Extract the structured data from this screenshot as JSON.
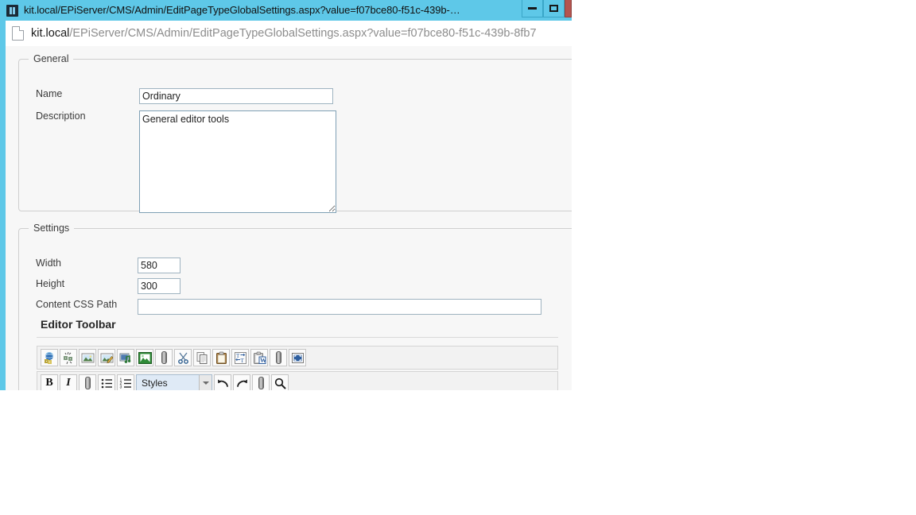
{
  "window": {
    "title": "kit.local/EPiServer/CMS/Admin/EditPageTypeGlobalSettings.aspx?value=f07bce80-f51c-439b-…",
    "favicon_name": "episerver-favicon",
    "minimize_label": "Minimize",
    "maximize_label": "Maximize",
    "close_label": "Close",
    "accent_color": "#5ec8e8"
  },
  "address_bar": {
    "host": "kit.local",
    "path": "/EPiServer/CMS/Admin/EditPageTypeGlobalSettings.aspx?value=f07bce80-f51c-439b-8fb7",
    "page_icon_name": "page-icon"
  },
  "general": {
    "legend": "General",
    "name_label": "Name",
    "name_value": "Ordinary",
    "description_label": "Description",
    "description_value": "General editor tools"
  },
  "settings": {
    "legend": "Settings",
    "width_label": "Width",
    "width_value": "580",
    "height_label": "Height",
    "height_value": "300",
    "css_path_label": "Content CSS Path",
    "css_path_value": "",
    "css_path_placeholder": "",
    "editor_toolbar_heading": "Editor Toolbar"
  },
  "toolbar": {
    "row1": [
      {
        "name": "insert-edit-link-icon",
        "title": "Insert/edit link"
      },
      {
        "name": "unlink-icon",
        "title": "Unlink"
      },
      {
        "name": "insert-image-icon",
        "title": "Insert/edit image"
      },
      {
        "name": "edit-image-icon",
        "title": "Edit image"
      },
      {
        "name": "insert-media-icon",
        "title": "Insert/edit media"
      },
      {
        "name": "image-editor-icon",
        "title": "Image editor"
      },
      {
        "name": "separator-icon",
        "title": "Separator"
      },
      {
        "name": "cut-icon",
        "title": "Cut"
      },
      {
        "name": "copy-icon",
        "title": "Copy"
      },
      {
        "name": "paste-icon",
        "title": "Paste"
      },
      {
        "name": "paste-as-plain-text-icon",
        "title": "Paste as plain text"
      },
      {
        "name": "paste-from-word-icon",
        "title": "Paste from Word"
      },
      {
        "name": "separator-icon",
        "title": "Separator"
      },
      {
        "name": "fullscreen-icon",
        "title": "Fullscreen"
      }
    ],
    "row2": [
      {
        "name": "bold-icon",
        "title": "Bold",
        "glyph": "B"
      },
      {
        "name": "italic-icon",
        "title": "Italic",
        "glyph": "I"
      },
      {
        "name": "separator-icon",
        "title": "Separator",
        "glyph": ""
      },
      {
        "name": "bullet-list-icon",
        "title": "Bullet list",
        "glyph": ""
      },
      {
        "name": "numbered-list-icon",
        "title": "Numbered list",
        "glyph": ""
      },
      {
        "name": "styles-select",
        "title": "Styles",
        "glyph": ""
      },
      {
        "name": "undo-icon",
        "title": "Undo",
        "glyph": ""
      },
      {
        "name": "redo-icon",
        "title": "Redo",
        "glyph": ""
      },
      {
        "name": "separator-icon",
        "title": "Separator",
        "glyph": ""
      },
      {
        "name": "search-icon",
        "title": "Find",
        "glyph": ""
      }
    ],
    "styles_selected": "Styles"
  }
}
